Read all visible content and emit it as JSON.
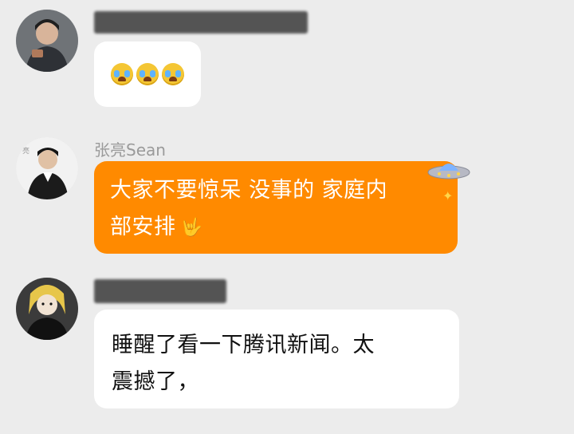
{
  "messages": [
    {
      "sender_name": "",
      "sender_name_blurred": true,
      "content_type": "emoji",
      "emojis": [
        "crying-face",
        "crying-face",
        "crying-face"
      ]
    },
    {
      "sender_name": "张亮Sean",
      "sender_name_blurred": false,
      "content_type": "text",
      "bubble_color": "#ff8a00",
      "line1": "大家不要惊呆 没事的 家庭内",
      "line2": "部安排",
      "trailing_emoji": "🤟",
      "decoration": "ufo-icon"
    },
    {
      "sender_name": "",
      "sender_name_blurred": true,
      "content_type": "text",
      "bubble_color": "#ffffff",
      "line1": "睡醒了看一下腾讯新闻。太",
      "line2": "震撼了，"
    }
  ]
}
